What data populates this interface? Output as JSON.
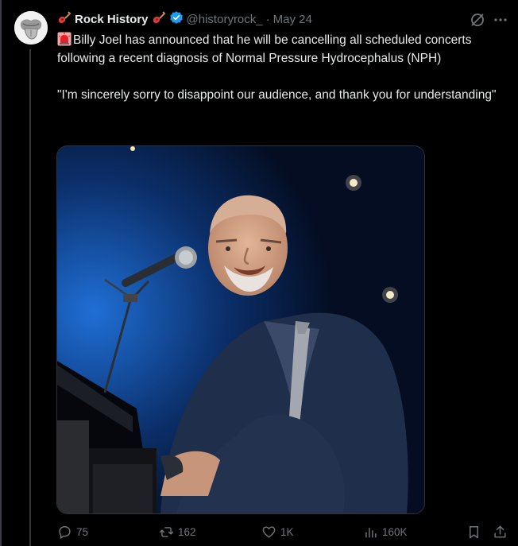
{
  "post": {
    "author_name": "Rock History",
    "author_handle": "@historyrock_",
    "separator": "·",
    "date": "May 24",
    "text_line1": "Billy Joel has announced that he will be cancelling all scheduled concerts following a recent diagnosis of Normal Pressure Hydrocephalus (NPH)",
    "text_line2": "\"I'm sincerely sorry to disappoint our audience, and thank you for understanding\""
  },
  "stats": {
    "replies": "75",
    "reposts": "162",
    "likes": "1K",
    "views": "160K"
  },
  "icons": {
    "avatar": "rolling-stones-tongue-logo",
    "name_emoji": "guitar",
    "verified": "verified-badge",
    "text_emoji": "siren",
    "grok": "grok-icon",
    "more": "more-icon",
    "reply": "reply-icon",
    "repost": "repost-icon",
    "like": "heart-icon",
    "views": "views-icon",
    "bookmark": "bookmark-icon",
    "share": "share-icon"
  },
  "colors": {
    "background": "#000000",
    "text": "#e7e9ea",
    "muted": "#71767b",
    "verified": "#1d9bf0"
  }
}
